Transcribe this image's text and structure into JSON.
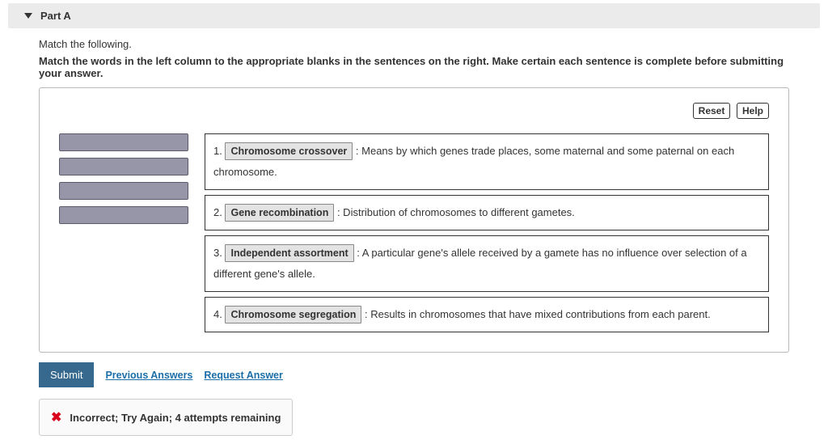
{
  "header": {
    "title": "Part A"
  },
  "instructions": {
    "line1": "Match the following.",
    "line2": "Match the words in the left column to the appropriate blanks in the sentences on the right. Make certain each sentence is complete before submitting your answer."
  },
  "toolbar": {
    "reset_label": "Reset",
    "help_label": "Help"
  },
  "sentences": [
    {
      "num": "1.",
      "chip": "Chromosome crossover",
      "before": "",
      "after": ": Means by which genes trade places, some maternal and some paternal on each chromosome."
    },
    {
      "num": "2.",
      "chip": "Gene recombination",
      "before": "",
      "after": ": Distribution of chromosomes to different gametes."
    },
    {
      "num": "3.",
      "chip": "Independent assortment",
      "before": "",
      "after": ": A particular gene's allele received by a gamete has no influence over selection of a different gene's allele."
    },
    {
      "num": "4.",
      "chip": "Chromosome segregation",
      "before": "",
      "after": ": Results in chromosomes that have mixed contributions from each parent."
    }
  ],
  "actions": {
    "submit_label": "Submit",
    "previous_label": "Previous Answers",
    "request_label": "Request Answer"
  },
  "feedback": {
    "text": "Incorrect; Try Again; 4 attempts remaining"
  }
}
